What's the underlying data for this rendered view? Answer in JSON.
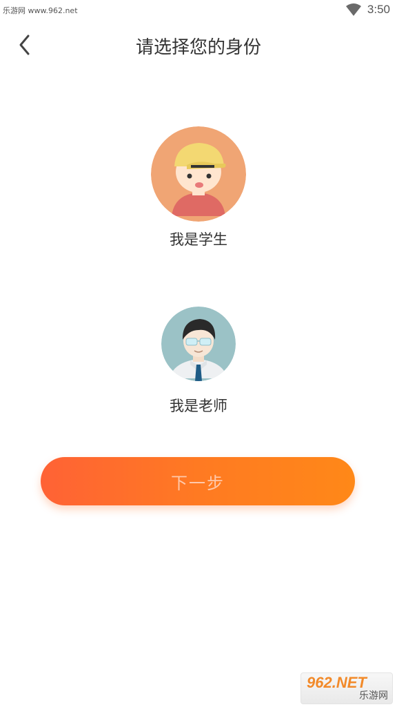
{
  "status_bar": {
    "watermark": "乐游网 www.962.net",
    "time": "3:50",
    "icons": [
      "wifi-icon"
    ]
  },
  "header": {
    "title": "请选择您的身份",
    "back_icon": "chevron-left-icon"
  },
  "roles": [
    {
      "label": "我是学生",
      "avatar_icon": "student-avatar"
    },
    {
      "label": "我是老师",
      "avatar_icon": "teacher-avatar"
    }
  ],
  "next_button": {
    "label": "下一步"
  },
  "watermark": {
    "brand": "962.NET",
    "sub": "乐游网"
  },
  "colors": {
    "accent_start": "#ff6235",
    "accent_end": "#ff8818",
    "title": "#333333"
  }
}
